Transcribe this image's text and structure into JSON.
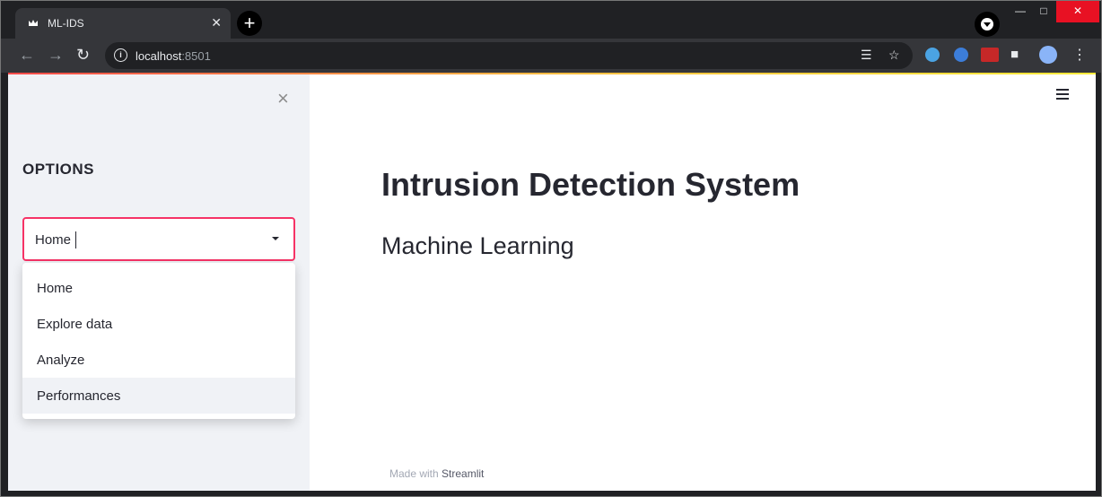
{
  "browser": {
    "tab_title": "ML-IDS",
    "tab_close": "✕",
    "new_tab": "+",
    "url_host": "localhost",
    "url_port": ":8501"
  },
  "sidebar": {
    "close_glyph": "×",
    "title": "OPTIONS",
    "select_value": "Home",
    "options": [
      "Home",
      "Explore data",
      "Analyze",
      "Performances"
    ],
    "highlighted_option": "Performances"
  },
  "main": {
    "title": "Intrusion Detection System",
    "subtitle": "Machine Learning"
  },
  "footer": {
    "made_with": "Made with",
    "brand": "Streamlit"
  },
  "colors": {
    "accent": "#f63366",
    "sidebar_bg": "#f0f2f6",
    "text": "#262730"
  }
}
